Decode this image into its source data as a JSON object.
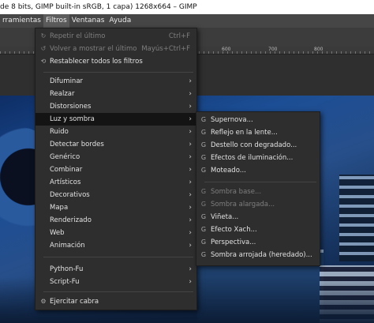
{
  "window": {
    "title": "de 8 bits, GIMP built-in sRGB, 1 capa) 1268x664 – GIMP"
  },
  "menubar": {
    "items": [
      "rramientas",
      "Filtros",
      "Ventanas",
      "Ayuda"
    ]
  },
  "ruler": {
    "ticks": [
      "600",
      "700",
      "800"
    ]
  },
  "filtros_menu": {
    "repeat": {
      "label": "Repetir el último",
      "shortcut": "Ctrl+F",
      "icon": "repeat-icon"
    },
    "reshow": {
      "label": "Volver a mostrar el último",
      "shortcut": "Mayús+Ctrl+F",
      "icon": "reshow-icon"
    },
    "reset": {
      "label": "Restablecer todos los filtros",
      "icon": "reset-icon"
    },
    "groups": [
      [
        "Difuminar",
        "Realzar",
        "Distorsiones",
        "Luz y sombra",
        "Ruido",
        "Detectar bordes",
        "Genérico",
        "Combinar",
        "Artísticos",
        "Decorativos",
        "Mapa",
        "Renderizado",
        "Web",
        "Animación"
      ],
      [
        "Python-Fu",
        "Script-Fu"
      ]
    ],
    "highlighted": "Luz y sombra",
    "goat": {
      "label": "Ejercitar cabra",
      "icon": "goat-icon"
    }
  },
  "luz_menu": {
    "items_a": [
      {
        "label": "Supernova...",
        "disabled": false,
        "icon": "gegl-icon"
      },
      {
        "label": "Reflejo en la lente...",
        "disabled": false,
        "icon": "gegl-icon"
      },
      {
        "label": "Destello con degradado...",
        "disabled": false,
        "icon": "gegl-icon"
      },
      {
        "label": "Efectos de iluminación...",
        "disabled": false,
        "icon": "gegl-icon"
      },
      {
        "label": "Moteado...",
        "disabled": false,
        "icon": "gegl-icon"
      }
    ],
    "items_b": [
      {
        "label": "Sombra base...",
        "disabled": true,
        "icon": "gegl-icon"
      },
      {
        "label": "Sombra alargada...",
        "disabled": true,
        "icon": "gegl-icon"
      },
      {
        "label": "Viñeta...",
        "disabled": false,
        "icon": "gegl-icon"
      },
      {
        "label": "Efecto Xach...",
        "disabled": false,
        "icon": "gegl-icon"
      },
      {
        "label": "Perspectiva...",
        "disabled": false,
        "icon": "gegl-icon"
      },
      {
        "label": "Sombra arrojada (heredado)...",
        "disabled": false,
        "icon": "gegl-icon"
      }
    ]
  }
}
